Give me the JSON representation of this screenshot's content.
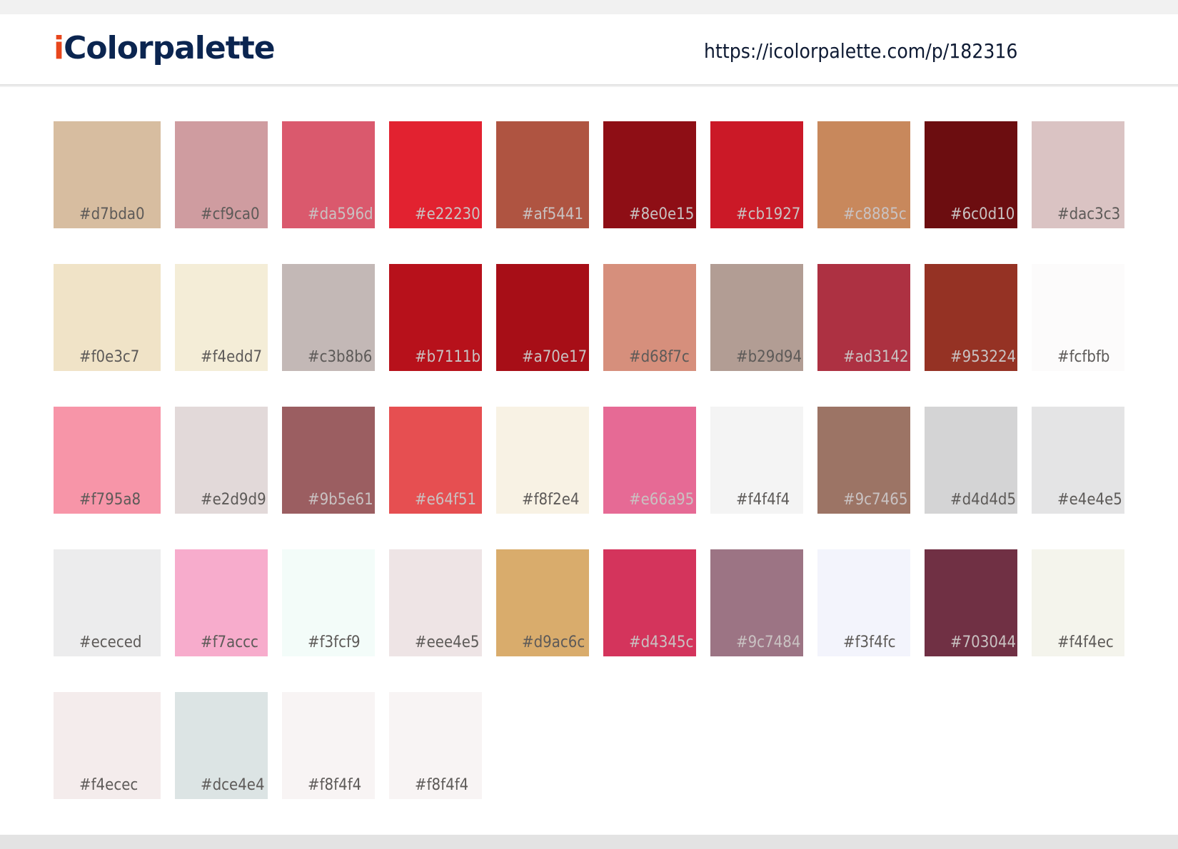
{
  "header": {
    "logo_first": "i",
    "logo_rest": "Colorpalette",
    "url": "https://icolorpalette.com/p/182316"
  },
  "swatches": [
    {
      "hex": "#d7bda0",
      "label": "#d7bda0"
    },
    {
      "hex": "#cf9ca0",
      "label": "#cf9ca0"
    },
    {
      "hex": "#da596d",
      "label": "#da596d"
    },
    {
      "hex": "#e22230",
      "label": "#e22230"
    },
    {
      "hex": "#af5441",
      "label": "#af5441"
    },
    {
      "hex": "#8e0e15",
      "label": "#8e0e15"
    },
    {
      "hex": "#cb1927",
      "label": "#cb1927"
    },
    {
      "hex": "#c8885c",
      "label": "#c8885c"
    },
    {
      "hex": "#6c0d10",
      "label": "#6c0d10"
    },
    {
      "hex": "#dac3c3",
      "label": "#dac3c3"
    },
    {
      "hex": "#f0e3c7",
      "label": "#f0e3c7"
    },
    {
      "hex": "#f4edd7",
      "label": "#f4edd7"
    },
    {
      "hex": "#c3b8b6",
      "label": "#c3b8b6"
    },
    {
      "hex": "#b7111b",
      "label": "#b7111b"
    },
    {
      "hex": "#a70e17",
      "label": "#a70e17"
    },
    {
      "hex": "#d68f7c",
      "label": "#d68f7c"
    },
    {
      "hex": "#b29d94",
      "label": "#b29d94"
    },
    {
      "hex": "#ad3142",
      "label": "#ad3142"
    },
    {
      "hex": "#953224",
      "label": "#953224"
    },
    {
      "hex": "#fcfbfb",
      "label": "#fcfbfb"
    },
    {
      "hex": "#f795a8",
      "label": "#f795a8"
    },
    {
      "hex": "#e2d9d9",
      "label": "#e2d9d9"
    },
    {
      "hex": "#9b5e61",
      "label": "#9b5e61"
    },
    {
      "hex": "#e64f51",
      "label": "#e64f51"
    },
    {
      "hex": "#f8f2e4",
      "label": "#f8f2e4"
    },
    {
      "hex": "#e66a95",
      "label": "#e66a95"
    },
    {
      "hex": "#f4f4f4",
      "label": "#f4f4f4"
    },
    {
      "hex": "#9c7465",
      "label": "#9c7465"
    },
    {
      "hex": "#d4d4d5",
      "label": "#d4d4d5"
    },
    {
      "hex": "#e4e4e5",
      "label": "#e4e4e5"
    },
    {
      "hex": "#ececed",
      "label": "#ececed"
    },
    {
      "hex": "#f7accc",
      "label": "#f7accc"
    },
    {
      "hex": "#f3fcf9",
      "label": "#f3fcf9"
    },
    {
      "hex": "#eee4e5",
      "label": "#eee4e5"
    },
    {
      "hex": "#d9ac6c",
      "label": "#d9ac6c"
    },
    {
      "hex": "#d4345c",
      "label": "#d4345c"
    },
    {
      "hex": "#9c7484",
      "label": "#9c7484"
    },
    {
      "hex": "#f3f4fc",
      "label": "#f3f4fc"
    },
    {
      "hex": "#703044",
      "label": "#703044"
    },
    {
      "hex": "#f4f4ec",
      "label": "#f4f4ec"
    },
    {
      "hex": "#f4ecec",
      "label": "#f4ecec"
    },
    {
      "hex": "#dce4e4",
      "label": "#dce4e4"
    },
    {
      "hex": "#f8f4f4",
      "label": "#f8f4f4"
    },
    {
      "hex": "#f8f4f4",
      "label": "#f8f4f4"
    }
  ],
  "colors": {
    "logo_accent": "#e8461c",
    "logo_main": "#0b2550",
    "label_on_light": "#5d5a58",
    "label_on_dark": "#c9c2c2"
  }
}
